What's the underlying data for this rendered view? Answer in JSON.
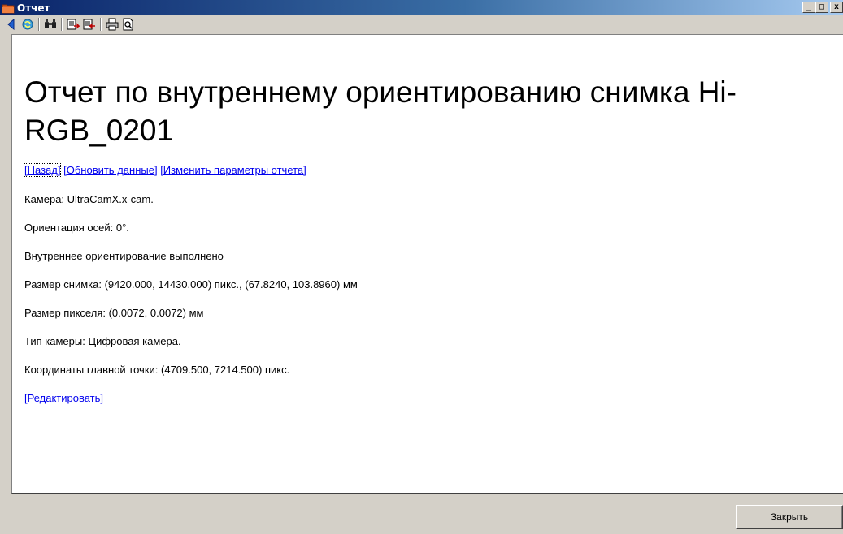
{
  "window": {
    "title": "Отчет",
    "app_icon": "folder-icon",
    "controls": {
      "minimize": "_",
      "maximize": "□",
      "close": "x"
    }
  },
  "toolbar": {
    "items": [
      {
        "icon": "back-arrow-icon"
      },
      {
        "icon": "refresh-icon"
      },
      {
        "icon": "binoculars-icon"
      },
      {
        "icon": "export-icon"
      },
      {
        "icon": "import-icon"
      },
      {
        "icon": "printer-icon"
      },
      {
        "icon": "print-preview-icon"
      }
    ]
  },
  "report": {
    "title": "Отчет по внутреннему ориентированию снимка Hi-RGB_0201",
    "links": {
      "back": "[Назад]",
      "refresh": "[Обновить данные]",
      "change_params": "[Изменить параметры отчета]"
    },
    "lines": {
      "camera": "Камера: UltraCamX.x-cam.",
      "axes": "Ориентация осей: 0°.",
      "status": "Внутреннее ориентирование выполнено",
      "image_size": "Размер снимка: (9420.000, 14430.000) пикс., (67.8240, 103.8960) мм",
      "pixel_size": "Размер пикселя: (0.0072, 0.0072) мм",
      "camera_type": "Тип камеры: Цифровая камера.",
      "principal_point": "Координаты главной точки: (4709.500, 7214.500) пикс."
    },
    "edit_link": "[Редактировать]"
  },
  "footer": {
    "close_label": "Закрыть"
  },
  "colors": {
    "titlebar_start": "#0a246a",
    "link": "#0000ee",
    "dialog_bg": "#d4d0c8"
  }
}
